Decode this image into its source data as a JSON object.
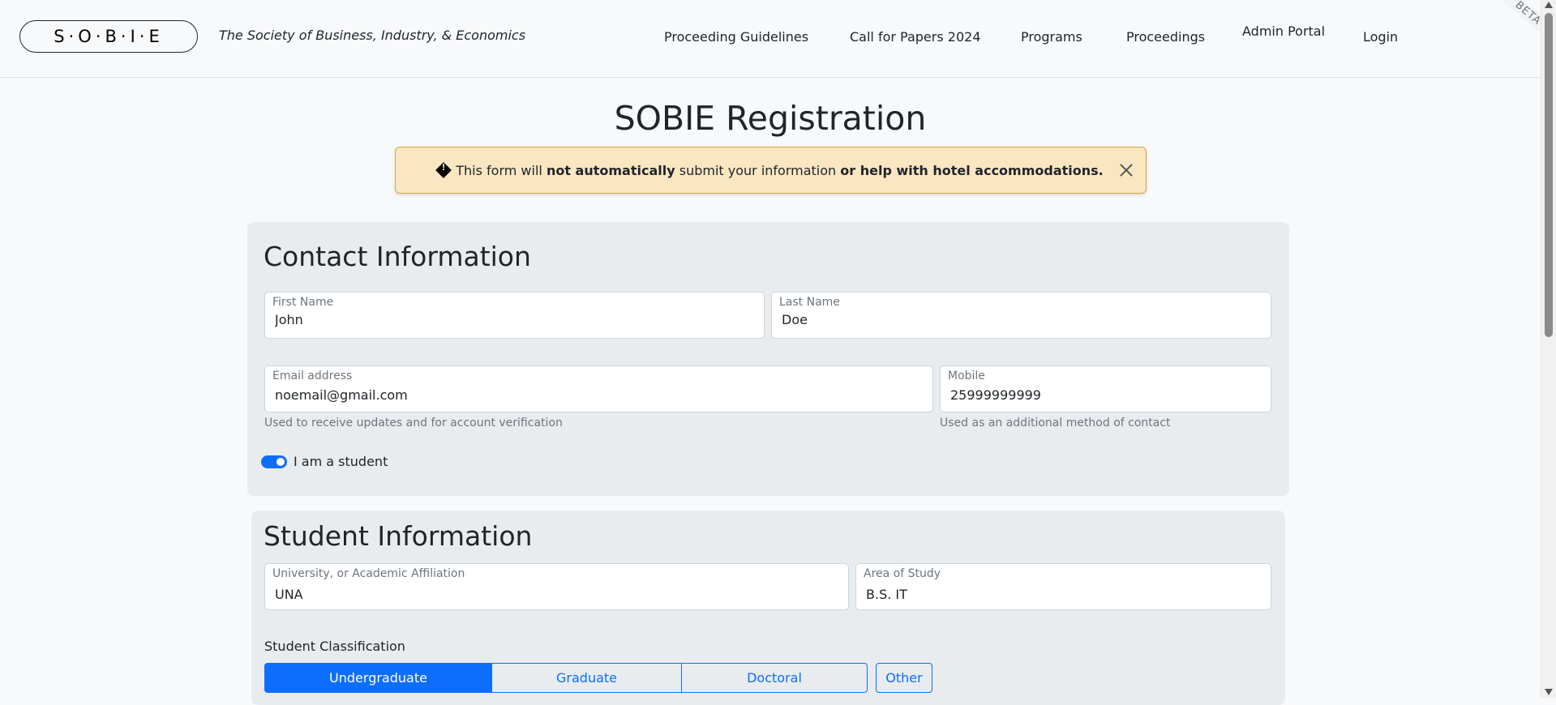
{
  "nav": {
    "brand": "S·O·B·I·E",
    "tagline": "The Society of Business, Industry, & Economics",
    "links": [
      "Proceeding Guidelines",
      "Call for Papers 2024",
      "Programs",
      "Proceedings",
      "Admin Portal",
      "Login"
    ],
    "beta": "BETA"
  },
  "page": {
    "title": "SOBIE Registration"
  },
  "alert": {
    "icon": "warning-diamond-icon",
    "text_1": "This form will ",
    "bold_1": "not automatically",
    "text_2": " submit your information ",
    "bold_2": "or help with hotel accommodations."
  },
  "contact": {
    "title": "Contact Information",
    "first_name": {
      "label": "First Name",
      "value": "John"
    },
    "last_name": {
      "label": "Last Name",
      "value": "Doe"
    },
    "email": {
      "label": "Email address",
      "value": "noemail@gmail.com",
      "help": "Used to receive updates and for account verification"
    },
    "mobile": {
      "label": "Mobile",
      "value": "25999999999",
      "help": "Used as an additional method of contact"
    },
    "student_toggle": {
      "label": "I am a student",
      "checked": true
    }
  },
  "student": {
    "title": "Student Information",
    "affiliation": {
      "label": "University, or Academic Affiliation",
      "value": "UNA"
    },
    "area": {
      "label": "Area of Study",
      "value": "B.S. IT"
    },
    "classification_label": "Student Classification",
    "classifications": [
      "Undergraduate",
      "Graduate",
      "Doctoral",
      "Other"
    ],
    "selected": "Undergraduate"
  },
  "colors": {
    "primary": "#0d6efd",
    "alert_bg": "#fbe6c2",
    "card_bg": "#e9ecef"
  }
}
